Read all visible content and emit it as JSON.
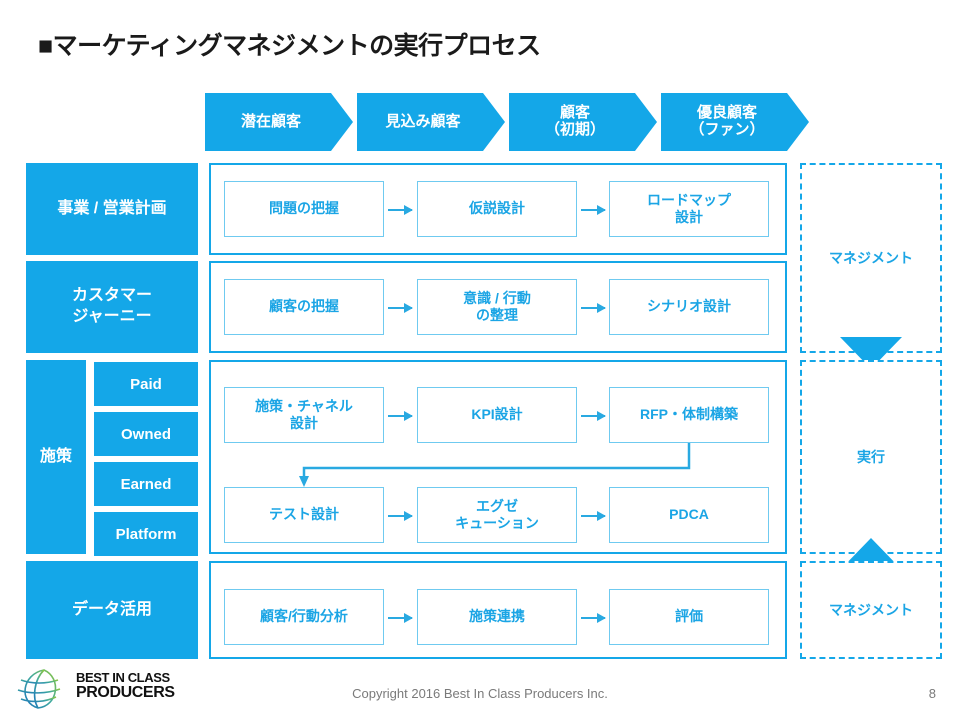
{
  "slide": {
    "title": "■マーケティングマネジメントの実行プロセス",
    "accent_color": "#14A7E8",
    "box_text_color": "#1BA5E5",
    "box_border_color": "#6FCAF0"
  },
  "stages": [
    {
      "label": "潜在顧客"
    },
    {
      "label": "見込み顧客"
    },
    {
      "label": "顧客\n（初期）"
    },
    {
      "label": "優良顧客\n（ファン）"
    }
  ],
  "rows": [
    {
      "label": "事業 / 営業計画",
      "steps": [
        {
          "label": "問題の把握"
        },
        {
          "label": "仮説設計"
        },
        {
          "label": "ロードマップ\n設計"
        }
      ]
    },
    {
      "label": "カスタマー\nジャーニー",
      "steps": [
        {
          "label": "顧客の把握"
        },
        {
          "label": "意識 / 行動\nの整理"
        },
        {
          "label": "シナリオ設計"
        }
      ]
    },
    {
      "label": "施策",
      "sub_labels": [
        {
          "label": "Paid"
        },
        {
          "label": "Owned"
        },
        {
          "label": "Earned"
        },
        {
          "label": "Platform"
        }
      ],
      "steps_top": [
        {
          "label": "施策・チャネル\n設計"
        },
        {
          "label": "KPI設計"
        },
        {
          "label": "RFP・体制構築"
        }
      ],
      "steps_bottom": [
        {
          "label": "テスト設計"
        },
        {
          "label": "エグゼ\nキューション"
        },
        {
          "label": "PDCA"
        }
      ]
    },
    {
      "label": "データ活用",
      "steps": [
        {
          "label": "顧客/行動分析"
        },
        {
          "label": "施策連携"
        },
        {
          "label": "評価"
        }
      ]
    }
  ],
  "right_column": [
    {
      "label": "マネジメント"
    },
    {
      "label": "実行"
    },
    {
      "label": "マネジメント"
    }
  ],
  "footer": {
    "logo_line1": "BEST IN CLASS",
    "logo_line2": "PRODUCERS",
    "copyright": "Copyright 2016 Best In Class Producers Inc.",
    "page_number": "8"
  }
}
